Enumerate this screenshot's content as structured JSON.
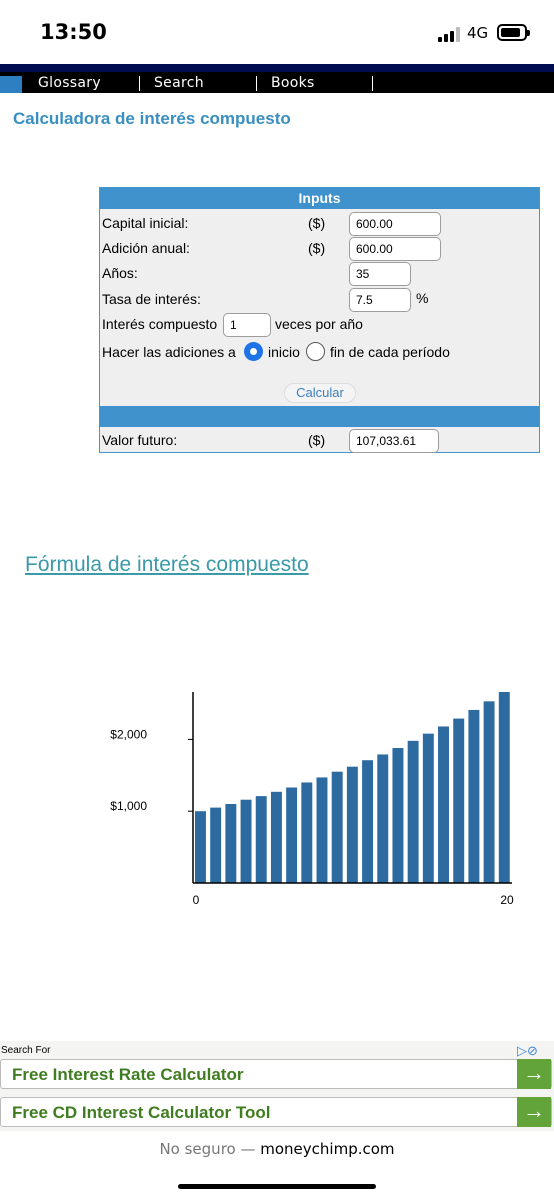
{
  "status_bar": {
    "time": "13:50",
    "network": "4G"
  },
  "nav": {
    "items": [
      "Glossary",
      "Search",
      "Books"
    ]
  },
  "page": {
    "title": "Calculadora de interés compuesto"
  },
  "calculator": {
    "header": "Inputs",
    "rows": {
      "capital": {
        "label": "Capital inicial:",
        "unit": "($)",
        "value": "600.00"
      },
      "addition": {
        "label": "Adición anual:",
        "unit": "($)",
        "value": "600.00"
      },
      "years": {
        "label": "Años:",
        "value": "35"
      },
      "rate": {
        "label": "Tasa de interés:",
        "value": "7.5",
        "suffix": "%"
      },
      "compound": {
        "label": "Interés compuesto",
        "value": "1",
        "suffix": "veces por año"
      },
      "timing": {
        "label": "Hacer las adiciones a",
        "option_start": "inicio",
        "option_end": "fin de cada período",
        "selected": "inicio"
      }
    },
    "button": "Calcular",
    "result": {
      "label": "Valor futuro:",
      "unit": "($)",
      "value": "107,033.61"
    }
  },
  "formula_link": "Fórmula de interés compuesto",
  "chart_data": {
    "type": "bar",
    "x": [
      0,
      1,
      2,
      3,
      4,
      5,
      6,
      7,
      8,
      9,
      10,
      11,
      12,
      13,
      14,
      15,
      16,
      17,
      18,
      19,
      20
    ],
    "values": [
      1000,
      1050,
      1100,
      1160,
      1210,
      1270,
      1330,
      1400,
      1470,
      1550,
      1620,
      1710,
      1790,
      1880,
      1980,
      2080,
      2180,
      2290,
      2410,
      2530,
      2660
    ],
    "x_tick_labels": [
      "0",
      "20"
    ],
    "y_tick_labels": [
      "$1,000",
      "$2,000"
    ],
    "y_ticks": [
      1000,
      2000
    ],
    "ylim": [
      0,
      2660
    ],
    "bar_color": "#2c6aa0",
    "title": "",
    "xlabel": "",
    "ylabel": ""
  },
  "ad": {
    "search_for": "Search For",
    "items": [
      "Free Interest Rate Calculator",
      "Free CD Interest Calculator Tool"
    ]
  },
  "url_bar": {
    "insecure_label": "No seguro —",
    "domain": "moneychimp.com"
  }
}
